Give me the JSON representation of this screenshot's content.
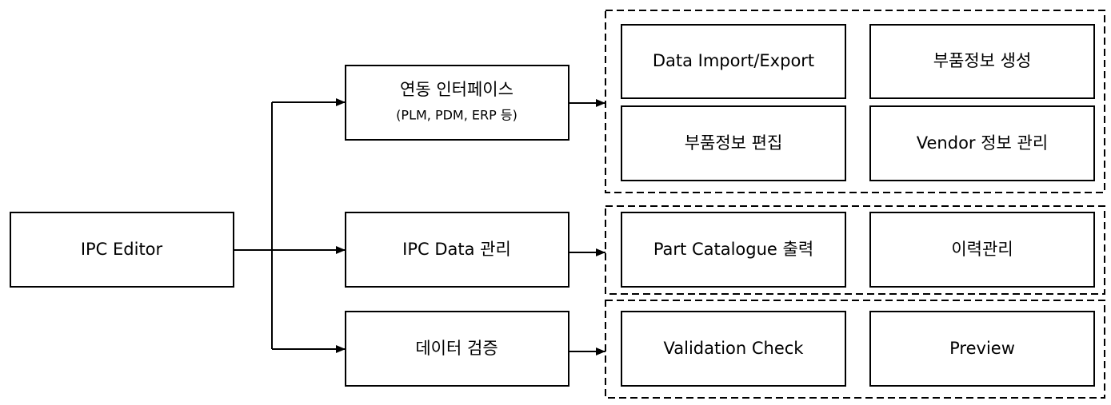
{
  "root": {
    "label": "IPC Editor"
  },
  "modules": [
    {
      "label": "연동 인터페이스",
      "sublabel": "(PLM, PDM, ERP 등)",
      "functions": [
        "Data Import/Export",
        "부품정보 생성",
        "부품정보 편집",
        "Vendor 정보 관리"
      ]
    },
    {
      "label": "IPC Data 관리",
      "functions": [
        "Part Catalogue 출력",
        "이력관리"
      ]
    },
    {
      "label": "데이터 검증",
      "functions": [
        "Validation Check",
        "Preview"
      ]
    }
  ]
}
